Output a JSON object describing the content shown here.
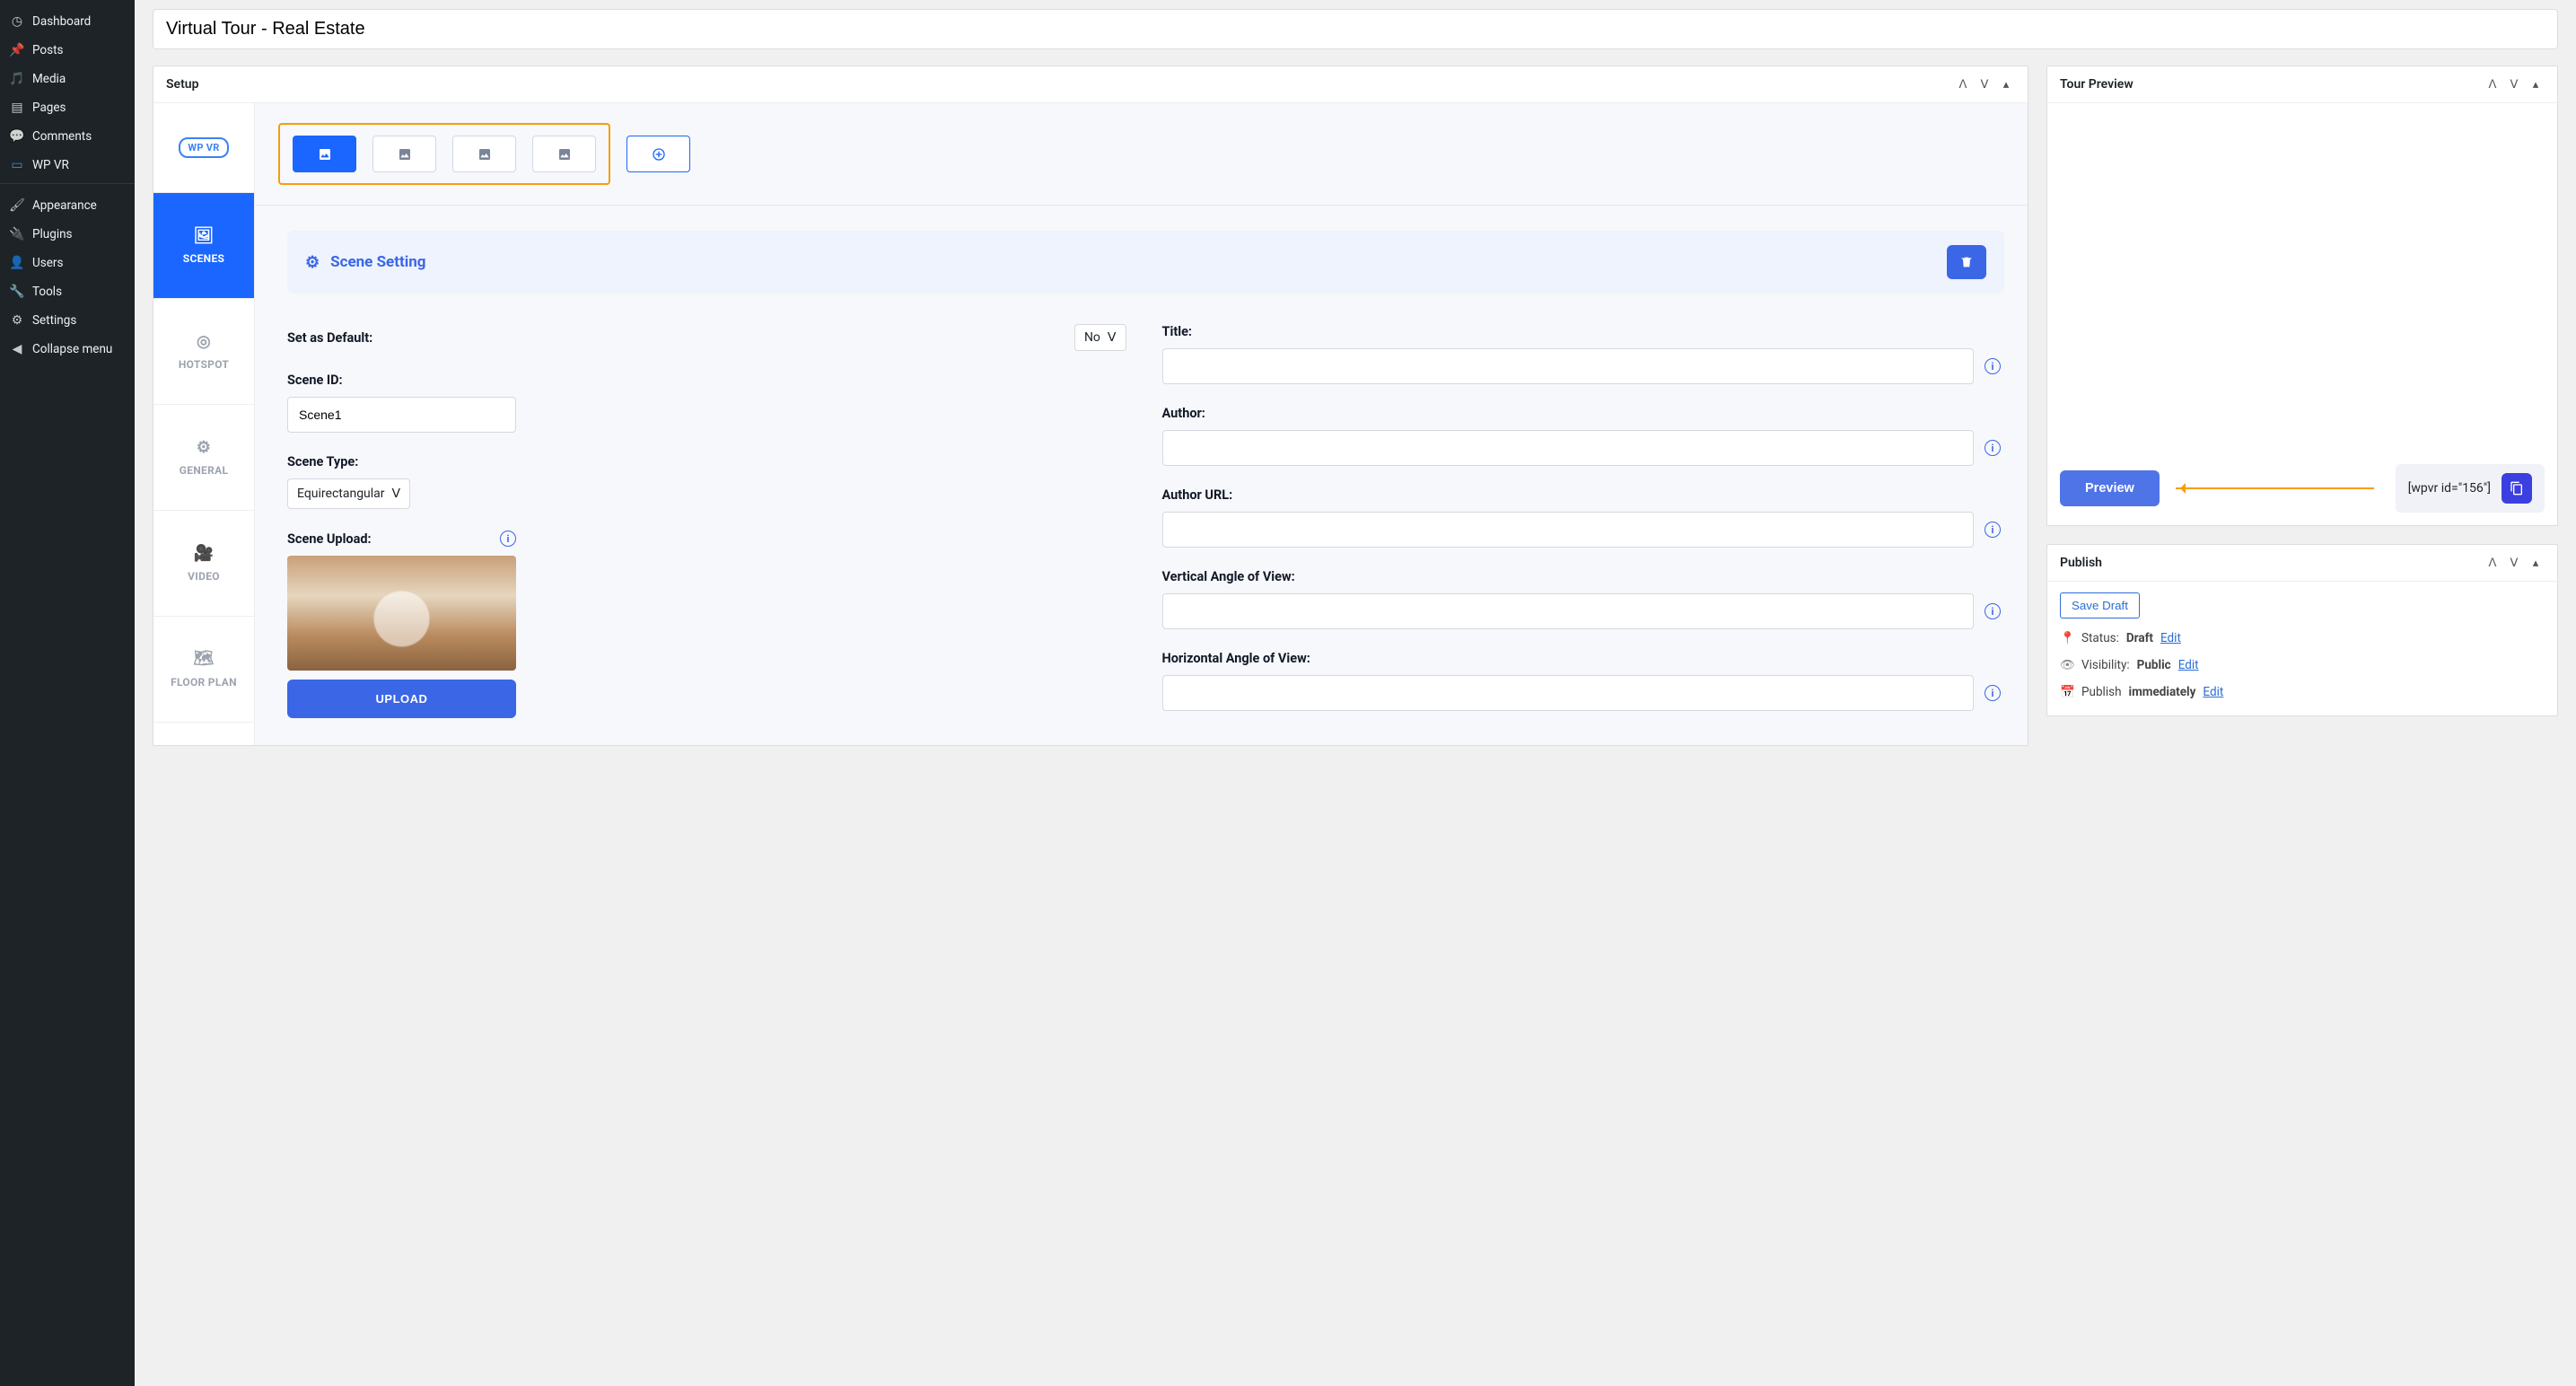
{
  "title_input": "Virtual Tour - Real Estate",
  "sidebar": {
    "items": [
      {
        "label": "Dashboard",
        "icon": "dash"
      },
      {
        "label": "Posts",
        "icon": "pin"
      },
      {
        "label": "Media",
        "icon": "media"
      },
      {
        "label": "Pages",
        "icon": "page"
      },
      {
        "label": "Comments",
        "icon": "comment"
      },
      {
        "label": "WP VR",
        "icon": "vr"
      }
    ],
    "items2": [
      {
        "label": "Appearance",
        "icon": "brush"
      },
      {
        "label": "Plugins",
        "icon": "plug"
      },
      {
        "label": "Users",
        "icon": "user"
      },
      {
        "label": "Tools",
        "icon": "wrench"
      },
      {
        "label": "Settings",
        "icon": "sliders"
      },
      {
        "label": "Collapse menu",
        "icon": "collapse"
      }
    ]
  },
  "panels": {
    "setup": "Setup",
    "tour_preview": "Tour Preview",
    "publish": "Publish"
  },
  "brand": "WP VR",
  "vtabs": [
    {
      "label": "SCENES"
    },
    {
      "label": "HOTSPOT"
    },
    {
      "label": "GENERAL"
    },
    {
      "label": "VIDEO"
    },
    {
      "label": "FLOOR PLAN"
    }
  ],
  "scene_setting": "Scene Setting",
  "form": {
    "default_label": "Set as Default:",
    "default_value": "No",
    "scene_id_label": "Scene ID:",
    "scene_id_value": "Scene1",
    "scene_type_label": "Scene Type:",
    "scene_type_value": "Equirectangular",
    "scene_upload_label": "Scene Upload:",
    "upload_btn": "UPLOAD",
    "title_label": "Title:",
    "author_label": "Author:",
    "author_url_label": "Author URL:",
    "vangle_label": "Vertical Angle of View:",
    "hangle_label": "Horizontal Angle of View:"
  },
  "preview": {
    "button": "Preview",
    "shortcode": "[wpvr id=\"156\"]"
  },
  "publish": {
    "save_draft": "Save Draft",
    "status_label": "Status:",
    "status_value": "Draft",
    "visibility_label": "Visibility:",
    "visibility_value": "Public",
    "publish_label": "Publish",
    "publish_value": "immediately",
    "edit": "Edit"
  }
}
